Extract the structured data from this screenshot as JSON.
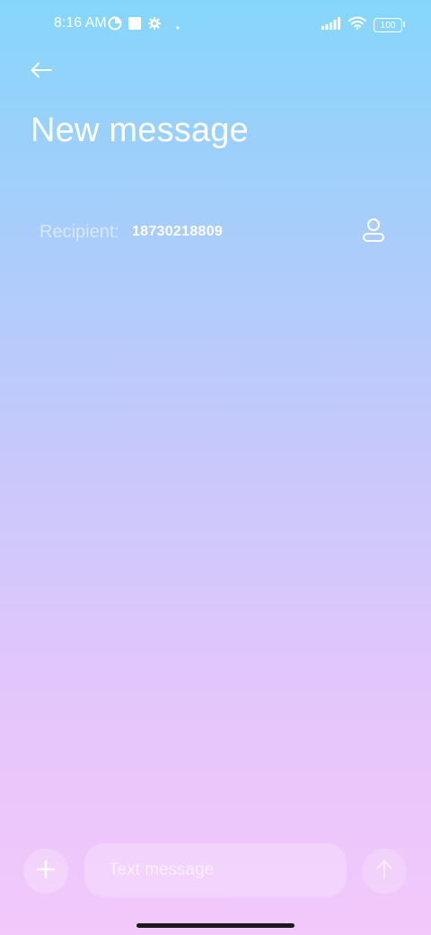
{
  "status_bar": {
    "time": "8:16 AM",
    "battery": "100",
    "icons": [
      "data-saver-icon",
      "square-notification-icon",
      "settings-gear-icon",
      "dot-icon",
      "signal-icon",
      "wifi-icon",
      "battery-icon"
    ]
  },
  "header": {
    "back_icon": "back-arrow-icon",
    "title": "New message"
  },
  "recipient": {
    "label": "Recipient:",
    "value": "18730218809",
    "contact_icon": "person-icon"
  },
  "composer": {
    "attach_icon": "plus-icon",
    "placeholder": "Text message",
    "value": "",
    "send_icon": "arrow-up-icon"
  },
  "colors": {
    "gradient_top": "#86d6fb",
    "gradient_bottom": "#f3c8fb",
    "text": "#ffffff"
  }
}
